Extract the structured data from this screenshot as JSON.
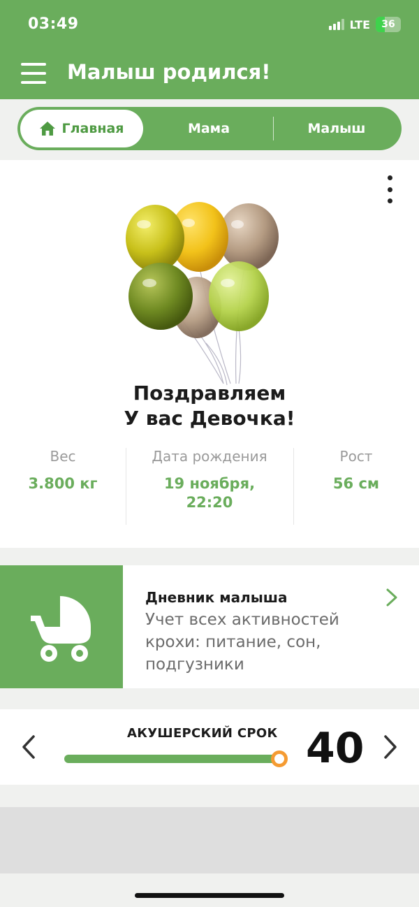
{
  "status": {
    "time": "03:49",
    "network": "LTE",
    "battery": "36"
  },
  "header": {
    "title": "Малыш родился!",
    "menu_icon": "hamburger-menu-icon"
  },
  "tabs": [
    {
      "label": "Главная",
      "icon": "home-icon",
      "active": true
    },
    {
      "label": "Мама",
      "active": false
    },
    {
      "label": "Малыш",
      "active": false
    }
  ],
  "congrats": {
    "line1": "Поздравляем",
    "line2": "У вас Девочка!",
    "image": "balloons-illustration"
  },
  "stats": [
    {
      "label": "Вес",
      "value": "3.800 кг"
    },
    {
      "label": "Дата рождения",
      "value_line1": "19 ноября,",
      "value_line2": "22:20"
    },
    {
      "label": "Рост",
      "value": "56 см"
    }
  ],
  "diary": {
    "title": "Дневник малыша",
    "description": "Учет всех активностей крохи: питание, сон, подгузники",
    "icon": "stroller-icon"
  },
  "term": {
    "label": "АКУШЕРСКИЙ СРОК",
    "value": "40",
    "progress": 1.0
  },
  "colors": {
    "brand_green": "#6aad5c",
    "accent_orange": "#f59b32"
  }
}
